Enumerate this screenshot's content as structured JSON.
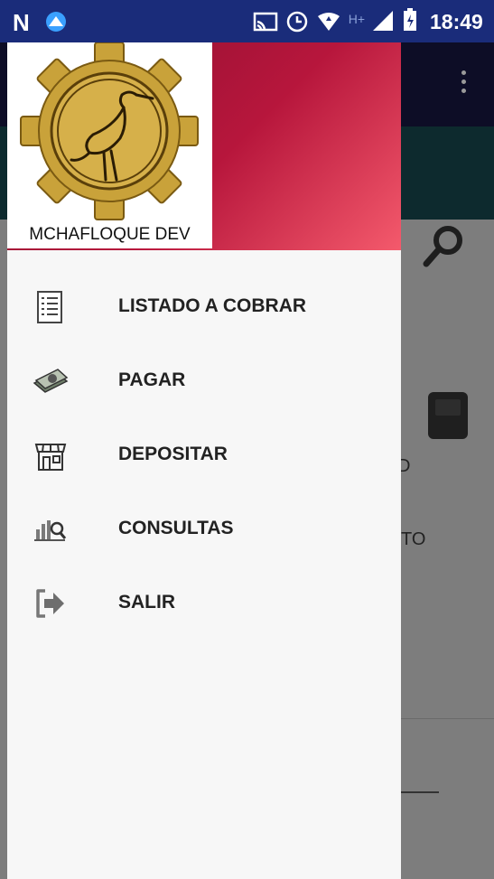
{
  "status_bar": {
    "time": "18:49",
    "left_icons": [
      "n-app-icon",
      "navigation-app-icon"
    ],
    "right_icons": [
      "cast-icon",
      "alarm-icon",
      "vpn-icon",
      "signal-icon",
      "battery-icon"
    ]
  },
  "background": {
    "partial_text_1": "D",
    "partial_text_2": "TO"
  },
  "drawer": {
    "logo_caption": "MCHAFLOQUE DEV",
    "items": [
      {
        "label": "LISTADO A COBRAR",
        "icon": "checklist-icon"
      },
      {
        "label": "PAGAR",
        "icon": "money-icon"
      },
      {
        "label": "DEPOSITAR",
        "icon": "store-icon"
      },
      {
        "label": "CONSULTAS",
        "icon": "chart-search-icon"
      },
      {
        "label": "SALIR",
        "icon": "exit-icon"
      }
    ]
  },
  "colors": {
    "header_gradient_start": "#8a0f30",
    "header_gradient_end": "#f45a6c",
    "status_bar": "#1a2c7a"
  }
}
